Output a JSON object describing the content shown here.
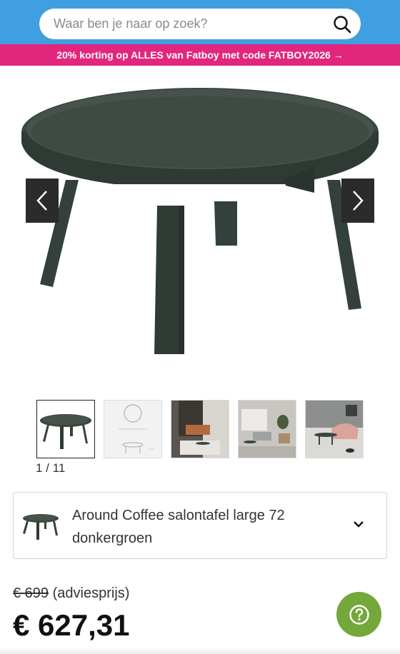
{
  "search": {
    "placeholder": "Waar ben je naar op zoek?"
  },
  "promo": {
    "text": "20% korting op ALLES van Fatboy met code FATBOY2026 →"
  },
  "gallery": {
    "counter": "1 / 11"
  },
  "variant": {
    "name": "Around Coffee salontafel large 72 donkergroen"
  },
  "price": {
    "old_value": "€ 699",
    "old_label": " (adviesprijs)",
    "current": "€ 627,31"
  },
  "colors": {
    "header": "#3f9fe0",
    "promo": "#e2267d",
    "help": "#74a83a",
    "table": "#3a463f"
  }
}
